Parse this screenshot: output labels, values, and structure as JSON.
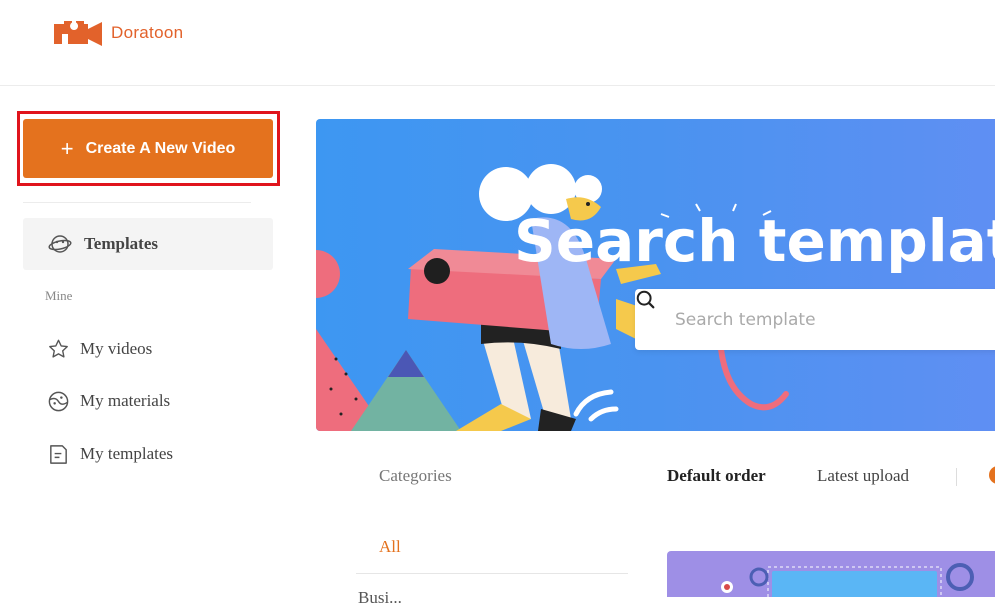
{
  "app": {
    "name": "Doratoon",
    "brand_color": "#e2622b"
  },
  "sidebar": {
    "create_button": {
      "label": "Create A New Video",
      "icon": "plus-icon",
      "color": "#e4721e",
      "highlight_color": "#e0141c"
    },
    "templates": {
      "label": "Templates",
      "icon": "planet-icon"
    },
    "section_label": "Mine",
    "items": [
      {
        "label": "My videos",
        "icon": "star-outline-icon"
      },
      {
        "label": "My materials",
        "icon": "globe-face-icon"
      },
      {
        "label": "My templates",
        "icon": "document-icon"
      }
    ]
  },
  "banner": {
    "title": "Search template t",
    "search_placeholder": "Search template",
    "search_icon": "search-icon",
    "gradient": [
      "#3d97f2",
      "#5f8ff3"
    ]
  },
  "categories": {
    "title": "Categories",
    "items": [
      "All",
      "Busi..."
    ],
    "active_color": "#e4721e"
  },
  "sort": {
    "options": [
      "Default order",
      "Latest upload"
    ],
    "active": "Default order"
  }
}
